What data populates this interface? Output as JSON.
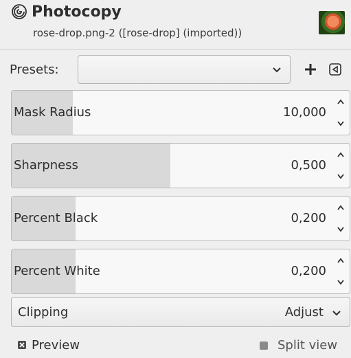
{
  "header": {
    "app_icon": "gimp-icon",
    "title": "Photocopy",
    "subtitle": "rose-drop.png-2 ([rose-drop] (imported))",
    "thumbnail_icon": "image-thumbnail"
  },
  "presets": {
    "label": "Presets:",
    "value": "",
    "add_icon": "plus-icon",
    "menu_icon": "triangle-left-icon"
  },
  "spinners": [
    {
      "label": "Mask Radius",
      "value": "10,000",
      "fill_fraction": 0.18
    },
    {
      "label": "Sharpness",
      "value": "0,500",
      "fill_fraction": 0.47
    },
    {
      "label": "Percent Black",
      "value": "0,200",
      "fill_fraction": 0.19
    },
    {
      "label": "Percent White",
      "value": "0,200",
      "fill_fraction": 0.19
    }
  ],
  "clipping": {
    "label": "Clipping",
    "value": "Adjust"
  },
  "footer": {
    "preview_label": "Preview",
    "preview_checked": true,
    "split_view_label": "Split view",
    "split_view_checked": false
  },
  "colors": {
    "background": "#efefef",
    "fill": "#d9d9d9",
    "text": "#2e2e2e"
  }
}
